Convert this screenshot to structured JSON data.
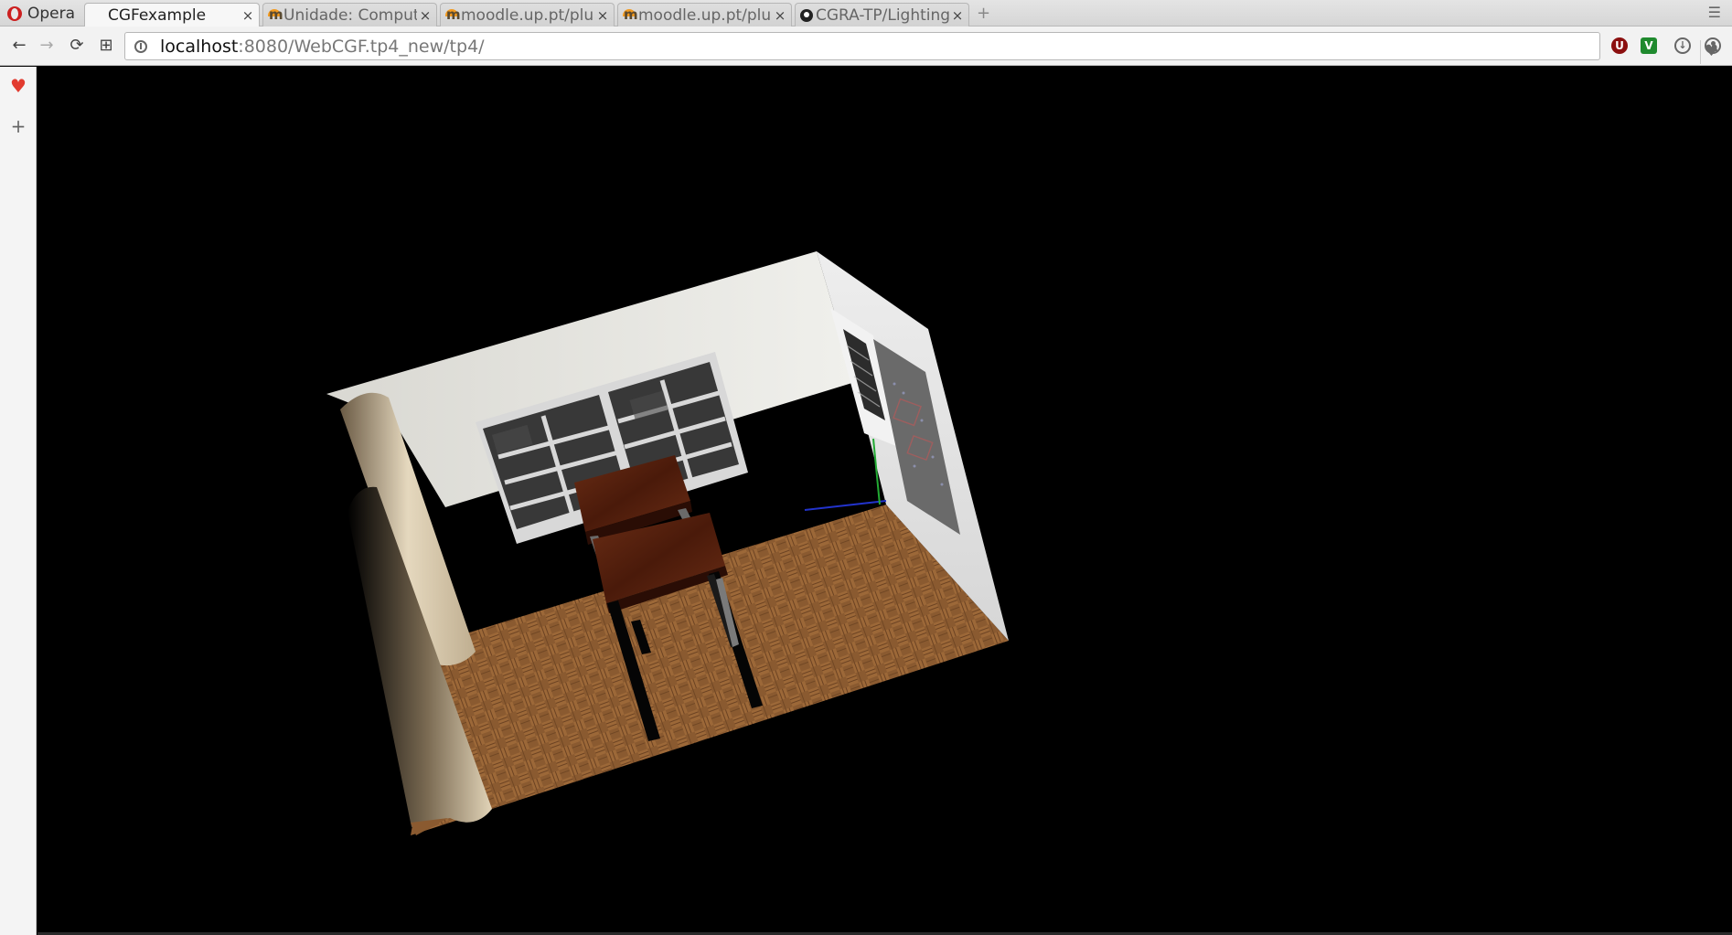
{
  "browser": {
    "menu_label": "Opera",
    "tabs": [
      {
        "label": "CGFexample",
        "favicon": "none",
        "active": true
      },
      {
        "label": "Unidade: Comput",
        "favicon": "moodle-icon",
        "active": false
      },
      {
        "label": "moodle.up.pt/plu",
        "favicon": "moodle-icon",
        "active": false
      },
      {
        "label": "moodle.up.pt/plu",
        "favicon": "moodle-icon",
        "active": false
      },
      {
        "label": "CGRA-TP/Lighting",
        "favicon": "github-icon",
        "active": false
      }
    ],
    "tab_close_glyph": "×",
    "new_tab_glyph": "+",
    "tab_menu_glyph": "☰"
  },
  "toolbar": {
    "back_glyph": "←",
    "forward_glyph": "→",
    "reload_glyph": "⟳",
    "speed_dial_glyph": "⊞",
    "url_host": "localhost",
    "url_rest": ":8080/WebCGF.tp4_new/tp4/",
    "bookmark_glyph": "♥",
    "extensions": {
      "ublock_label": "U",
      "vpn_label": "V",
      "download_label": "↓"
    }
  },
  "sidebar": {
    "heart_glyph": "♥",
    "add_glyph": "+"
  },
  "scene": {
    "description_label": "",
    "colors": {
      "background": "#000000",
      "wall_light": "#e2e2de",
      "wall_shadow": "#9a9a94",
      "floor": "#8a5a30",
      "floor_dark": "#5c3a1e",
      "table": "#5a2412",
      "chair_top": "#4e1c0c",
      "legs": "#050505",
      "column": "#d7c8ac",
      "window_frame": "#d6d6d6",
      "window_glass": "#3a3a3a",
      "board_white": "#f2f2f2",
      "board_dark": "#707070"
    }
  }
}
